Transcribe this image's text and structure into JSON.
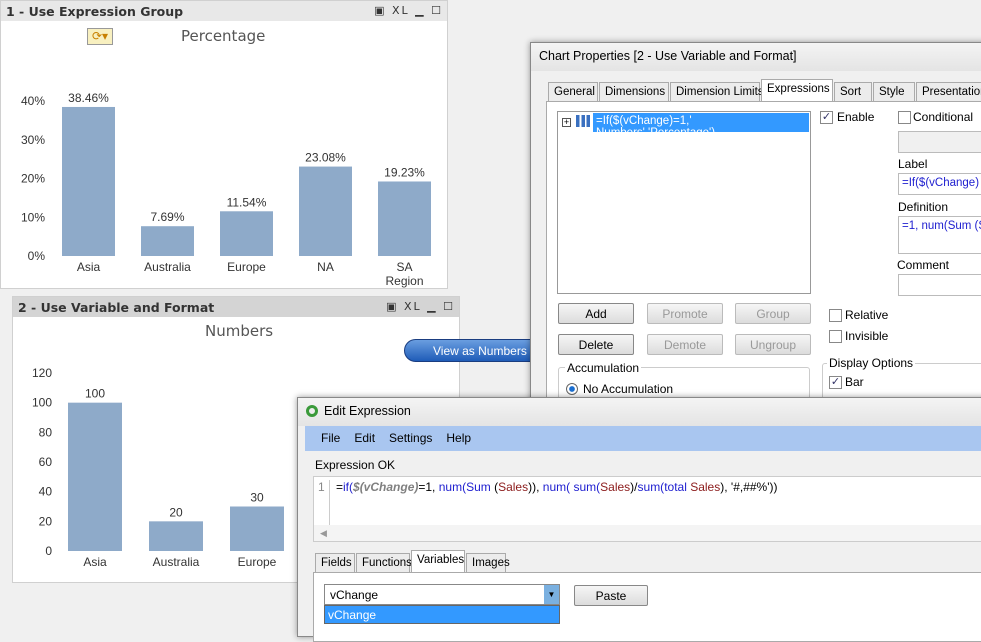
{
  "chart1": {
    "header": "1 - Use Expression Group",
    "header_icons": "▣ XL ▁ ☐",
    "title": "Percentage",
    "bar_color": "#8eaac9",
    "chart_data": {
      "type": "bar",
      "categories": [
        "Asia",
        "Australia",
        "Europe",
        "NA",
        "SA Region"
      ],
      "values": [
        38.46,
        7.69,
        11.54,
        23.08,
        19.23
      ],
      "data_labels": [
        "38.46%",
        "7.69%",
        "11.54%",
        "23.08%",
        "19.23%"
      ],
      "yticks": [
        "0%",
        "10%",
        "20%",
        "30%",
        "40%"
      ],
      "ylim": [
        0,
        40
      ],
      "title": "Percentage"
    }
  },
  "chart2": {
    "header": "2 - Use Variable and Format",
    "header_icons": "▣ XL ▁ ☐",
    "title": "Numbers",
    "bar_color": "#8eaac9",
    "chart_data": {
      "type": "bar",
      "categories": [
        "Asia",
        "Australia",
        "Europe"
      ],
      "values": [
        100,
        20,
        30
      ],
      "data_labels": [
        "100",
        "20",
        "30"
      ],
      "yticks": [
        "0",
        "20",
        "40",
        "60",
        "80",
        "100",
        "120"
      ],
      "ylim": [
        0,
        120
      ],
      "title": "Numbers"
    }
  },
  "view_button": "View as Numbers",
  "props": {
    "title": "Chart Properties [2 - Use Variable and Format]",
    "tabs": [
      "General",
      "Dimensions",
      "Dimension Limits",
      "Expressions",
      "Sort",
      "Style",
      "Presentation"
    ],
    "expression": "=If($(vChange)=1,' Numbers','Percentage')",
    "enable": "Enable",
    "conditional": "Conditional",
    "label": "Label",
    "label_value": "=If($(vChange)",
    "definition": "Definition",
    "definition_value": "=1, num(Sum (S",
    "comment": "Comment",
    "buttons": {
      "add": "Add",
      "promote": "Promote",
      "group": "Group",
      "delete": "Delete",
      "demote": "Demote",
      "ungroup": "Ungroup"
    },
    "relative": "Relative",
    "invisible": "Invisible",
    "accumulation": "Accumulation",
    "no_accumulation": "No Accumulation",
    "display_options": "Display Options",
    "bar": "Bar"
  },
  "edit": {
    "title": "Edit Expression",
    "menu": [
      "File",
      "Edit",
      "Settings",
      "Help"
    ],
    "status": "Expression OK",
    "line_no": "1",
    "expr_parts": [
      [
        "=",
        "#000"
      ],
      [
        "if(",
        "#2020d0"
      ],
      [
        "$(vChange)",
        "#808080"
      ],
      [
        "=1, ",
        "#000"
      ],
      [
        "num(",
        "#2020d0"
      ],
      [
        "Sum ",
        "#2020d0"
      ],
      [
        "(",
        "#000"
      ],
      [
        "Sales",
        "#8b1a1a"
      ],
      [
        ")), ",
        "#000"
      ],
      [
        "num( ",
        "#2020d0"
      ],
      [
        "sum(",
        "#2020d0"
      ],
      [
        "Sales",
        "#8b1a1a"
      ],
      [
        ")/",
        "#000"
      ],
      [
        "sum(",
        "#2020d0"
      ],
      [
        "total ",
        "#2020d0"
      ],
      [
        "Sales",
        "#8b1a1a"
      ],
      [
        "), '#,##%'))",
        "#000"
      ]
    ],
    "tabs": [
      "Fields",
      "Functions",
      "Variables",
      "Images"
    ],
    "variable_value": "vChange",
    "dropdown_option": "vChange",
    "paste": "Paste"
  }
}
